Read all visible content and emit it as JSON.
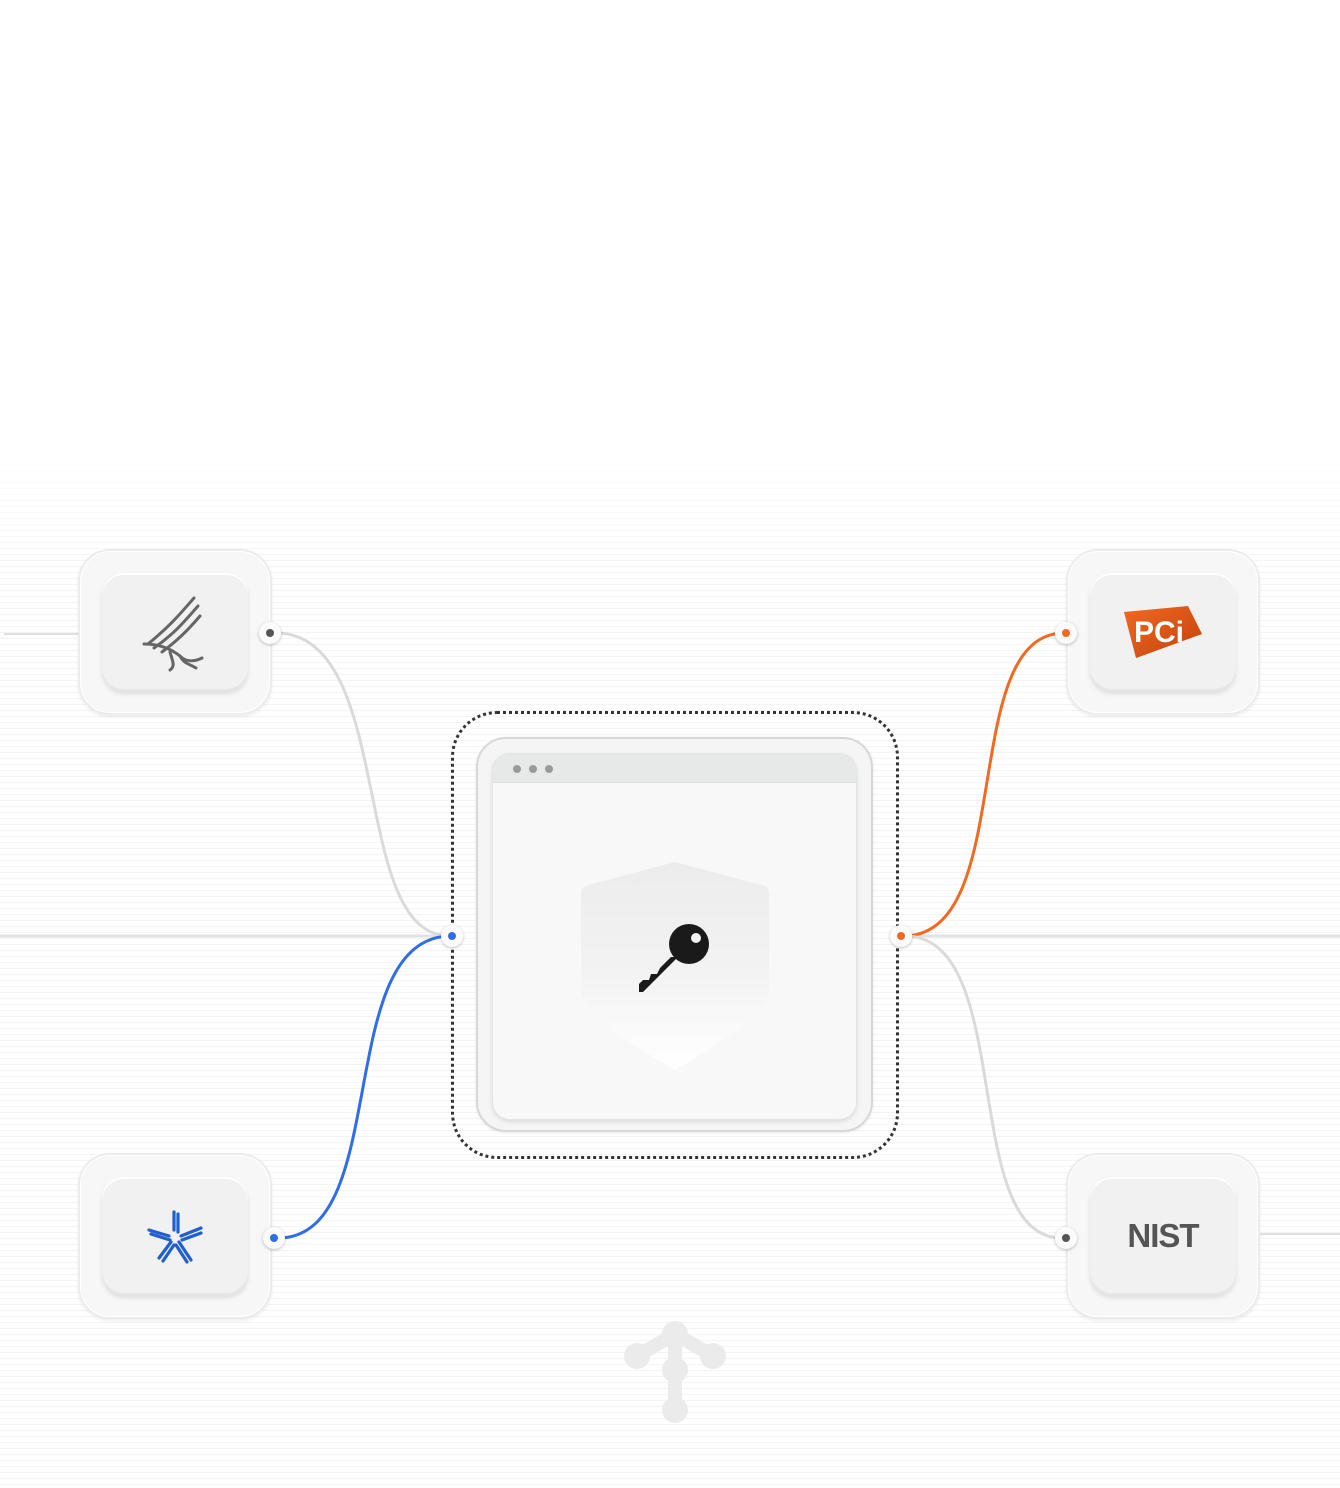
{
  "diagram": {
    "center": {
      "icon": "shield-key-icon",
      "window_dots": 3
    },
    "nodes": [
      {
        "id": "hhs",
        "icon": "hhs-eagle-logo",
        "side": "left",
        "connected": false,
        "link_color": "#d9d9d9"
      },
      {
        "id": "fedramp",
        "icon": "fedramp-star-logo",
        "side": "left",
        "connected": true,
        "link_color": "#2f6ee6"
      },
      {
        "id": "pci",
        "icon": "pci-logo",
        "label": "PCi",
        "side": "right",
        "connected": true,
        "link_color": "#f26a21"
      },
      {
        "id": "nist",
        "icon": "nist-logo",
        "label": "NIST",
        "side": "right",
        "connected": false,
        "link_color": "#d9d9d9"
      }
    ],
    "bottom_icon": "network-branch-icon"
  },
  "colors": {
    "accent_blue": "#2f6ee6",
    "accent_orange": "#f26a21",
    "neutral_link": "#d9d9d9",
    "background": "#ffffff"
  }
}
